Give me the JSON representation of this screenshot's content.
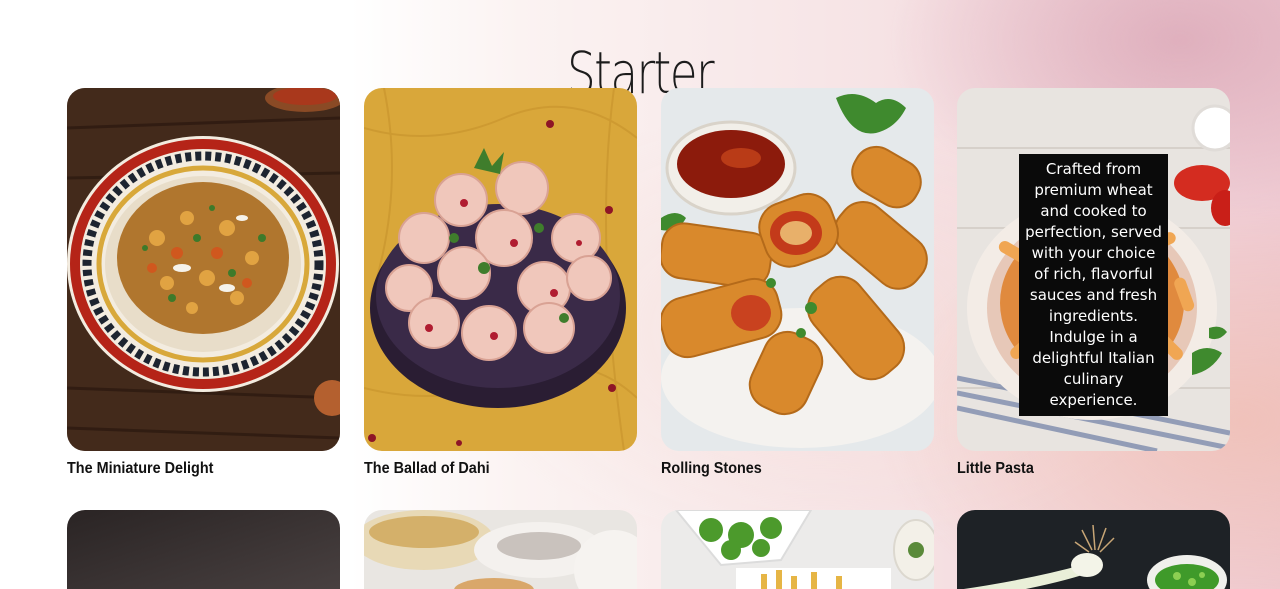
{
  "section": {
    "title": "Starter"
  },
  "cards": [
    {
      "name": "The Miniature Delight",
      "image_icon": "chaat-bowl-photo"
    },
    {
      "name": "The Ballad of Dahi",
      "image_icon": "dahi-puri-photo"
    },
    {
      "name": "Rolling Stones",
      "image_icon": "spring-rolls-photo"
    },
    {
      "name": "Little Pasta",
      "image_icon": "pasta-bowl-photo",
      "description": "Crafted from premium wheat and cooked to perfection, served with your choice of rich, flavorful sauces and fresh ingredients. Indulge in a delightful Italian culinary experience."
    }
  ],
  "second_row": [
    {
      "image_icon": "dark-dish-photo"
    },
    {
      "image_icon": "bowls-photo"
    },
    {
      "image_icon": "salad-fries-photo"
    },
    {
      "image_icon": "spring-onion-photo"
    }
  ],
  "colors": {
    "title": "#1c1c1c",
    "card_name": "#111111",
    "tooltip_bg": "#0a0a0a",
    "tooltip_text": "#ffffff"
  }
}
